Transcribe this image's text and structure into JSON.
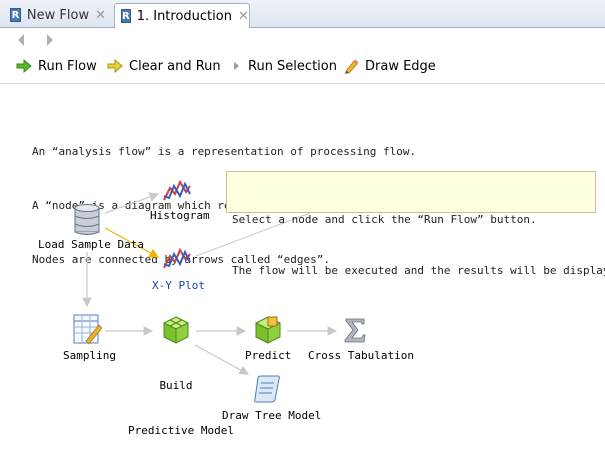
{
  "tabs": [
    {
      "label": "New Flow",
      "icon": "r-file-icon",
      "active": false
    },
    {
      "label": "1. Introduction",
      "icon": "r-file-icon",
      "active": true
    }
  ],
  "tab_close_glyph": "✕",
  "r_icon_letter": "R",
  "toolbar": {
    "run_flow": "Run Flow",
    "clear_and_run": "Clear and Run",
    "run_selection": "Run Selection",
    "draw_edge": "Draw Edge"
  },
  "intro_lines": [
    "An “analysis flow” is a representation of processing flow.",
    "A “node” is a diagram which represents a process unit.",
    "Nodes are connected by arrows called “edges”."
  ],
  "tooltip_lines": [
    "Select a node and click the “Run Flow” button.",
    "The flow will be executed and the results will be displayed."
  ],
  "nodes": {
    "load_sample_data": "Load Sample Data",
    "histogram": "Histogram",
    "xy_plot": "X-Y Plot",
    "sampling": "Sampling",
    "build_line1": "Build",
    "build_line2": "Predictive Model",
    "predict": "Predict",
    "cross_tabulation": "Cross Tabulation",
    "draw_tree_model": "Draw Tree Model"
  },
  "colors": {
    "accent": "#1a3fb0",
    "selected_edge": "#f0b400",
    "edge": "#c8c8c8",
    "tooltip_bg": "#ffffe1"
  }
}
